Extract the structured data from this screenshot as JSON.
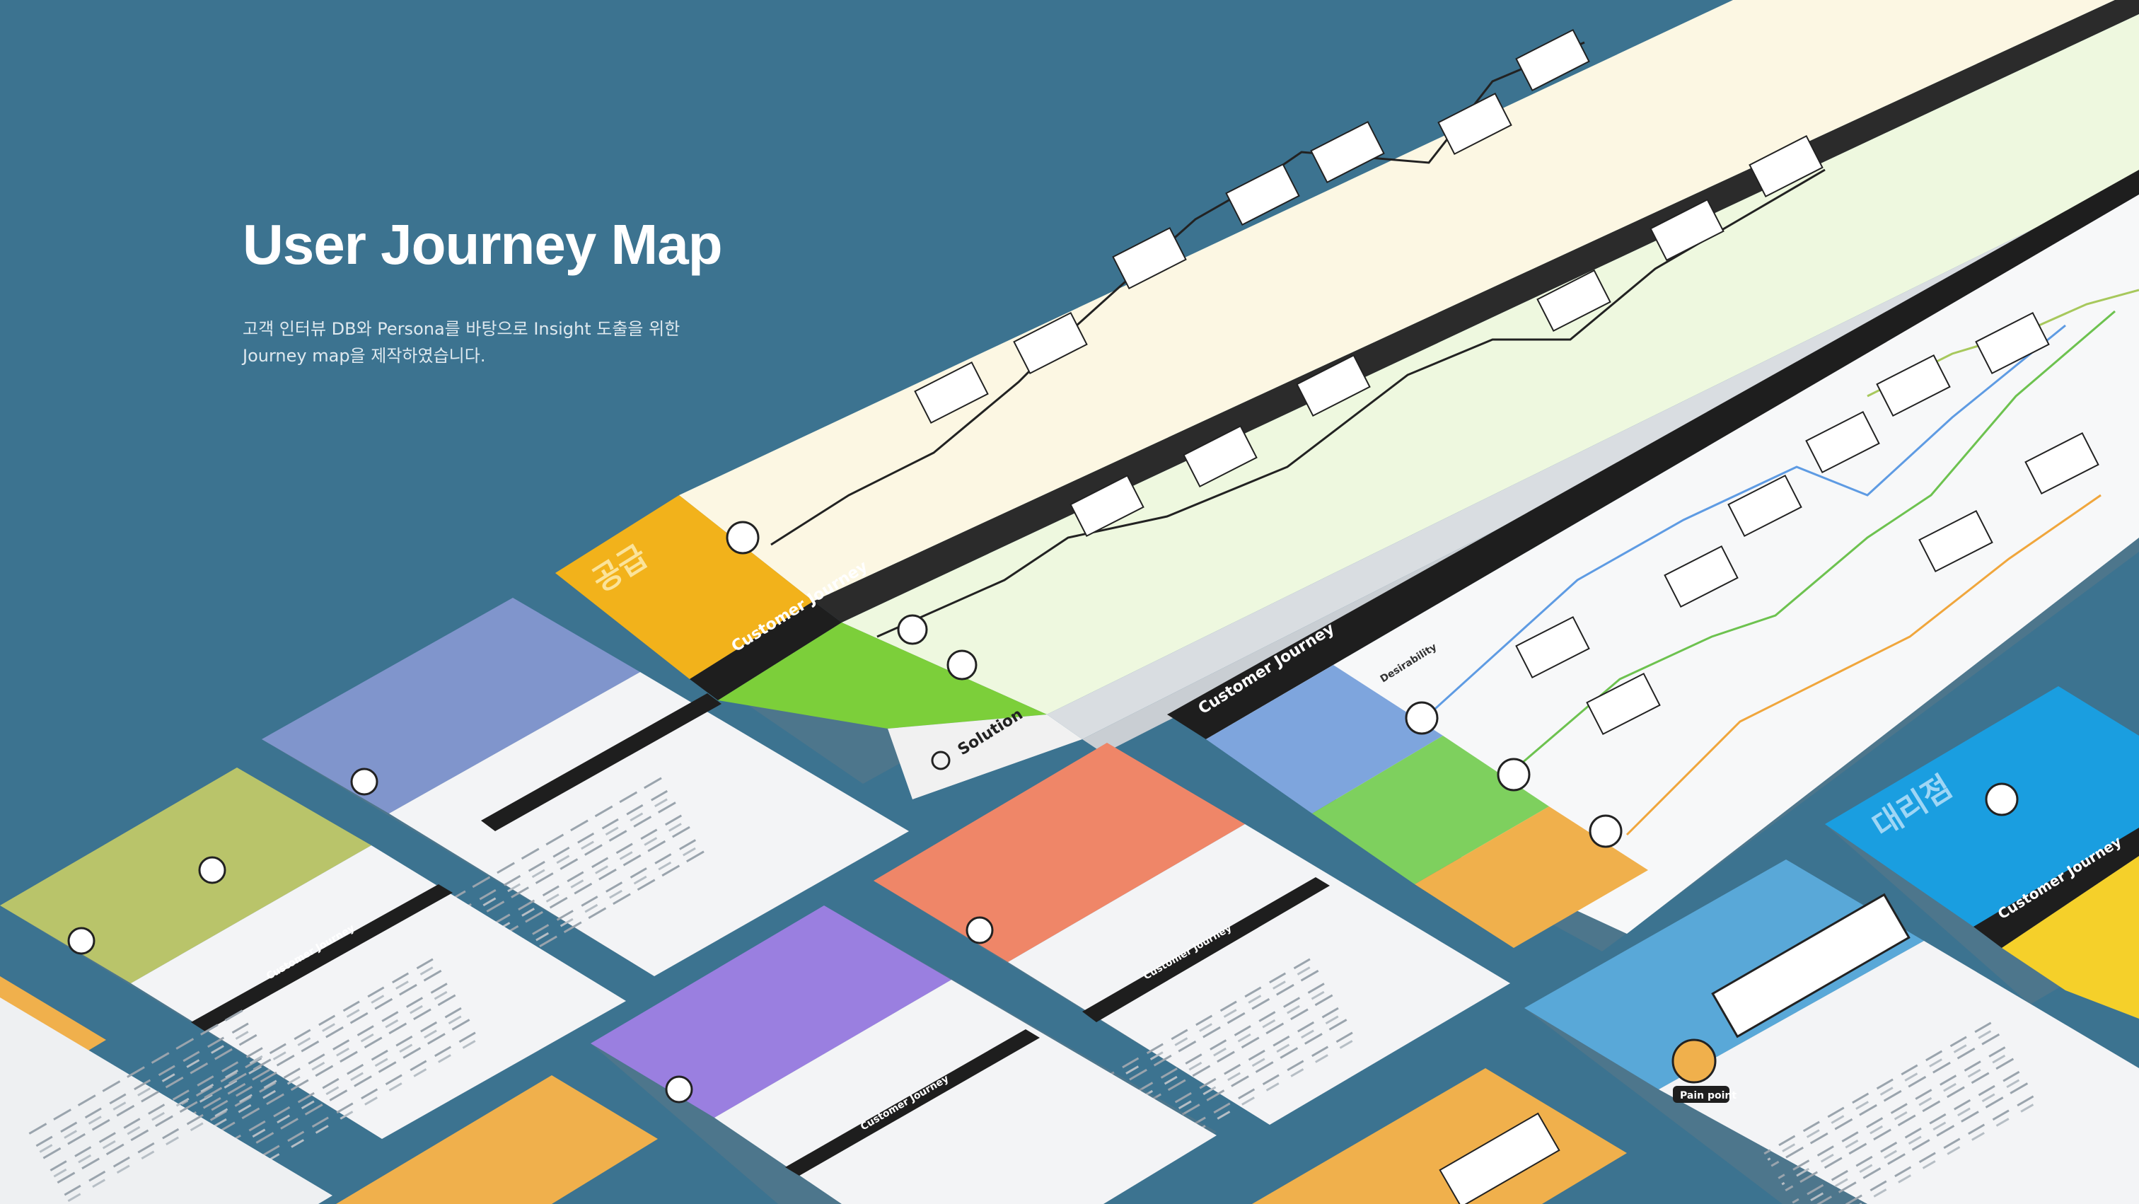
{
  "hero": {
    "title": "User Journey Map",
    "description_line1": "고객 인터뷰 DB와 Persona를 바탕으로 Insight 도출을 위한",
    "description_line2": "Journey map을 제작하였습니다."
  },
  "boards": {
    "supply_board": {
      "segment_label": "공급",
      "customer_journey_label": "Customer Journey",
      "solution_label": "Solution"
    },
    "main_board": {
      "customer_journey_label": "Customer Journey",
      "desirability_label": "Desirability"
    },
    "dealer_board": {
      "segment_label": "대리점",
      "customer_journey_label": "Customer Journey"
    }
  },
  "persona_cards": {
    "customer_journey_label": "Customer Journey",
    "pain_point_label": "Pain point"
  },
  "colors": {
    "background": "#3c7390",
    "supply_yellow": "#f2b21b",
    "green": "#7ccf3a",
    "dealer_blue": "#1a9ee0",
    "periwinkle": "#8095cc",
    "olive": "#b9c46a",
    "salmon": "#ef8668",
    "violet": "#9a7fe0",
    "orange": "#f0a63c",
    "sky": "#59a8d8",
    "cream": "#fcf7e3"
  }
}
